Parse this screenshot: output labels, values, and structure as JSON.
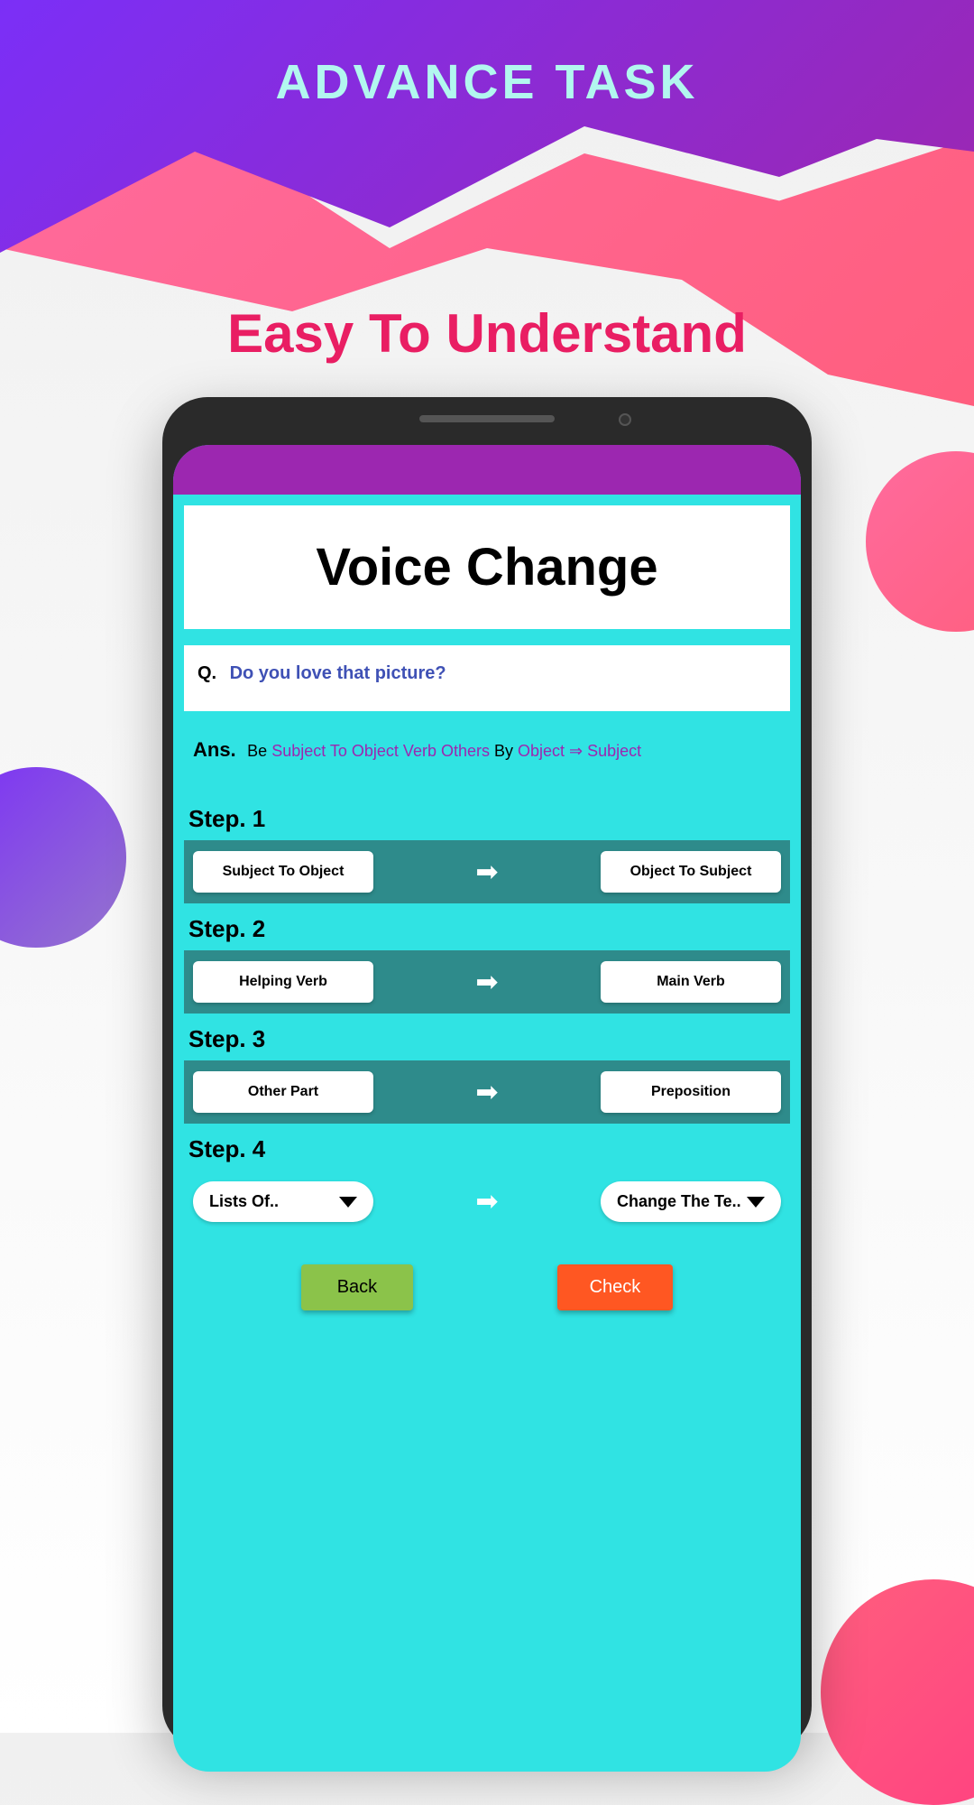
{
  "header": {
    "title": "ADVANCE TASK",
    "subtitle": "Easy To Understand"
  },
  "app": {
    "title": "Voice Change",
    "question": {
      "label": "Q.",
      "text": "Do you love that picture?"
    },
    "answer": {
      "label": "Ans.",
      "be": "Be",
      "part1": "Subject To Object  Verb  Others",
      "by": "By",
      "part2": "Object ⇒ Subject"
    },
    "steps": [
      {
        "label": "Step. 1",
        "left": "Subject To Object",
        "right": "Object To Subject",
        "type": "button"
      },
      {
        "label": "Step. 2",
        "left": "Helping Verb",
        "right": "Main Verb",
        "type": "button"
      },
      {
        "label": "Step. 3",
        "left": "Other Part",
        "right": "Preposition",
        "type": "button"
      },
      {
        "label": "Step. 4",
        "left": "Lists Of..",
        "right": "Change The Te..",
        "type": "dropdown"
      }
    ],
    "buttons": {
      "back": "Back",
      "check": "Check"
    }
  }
}
